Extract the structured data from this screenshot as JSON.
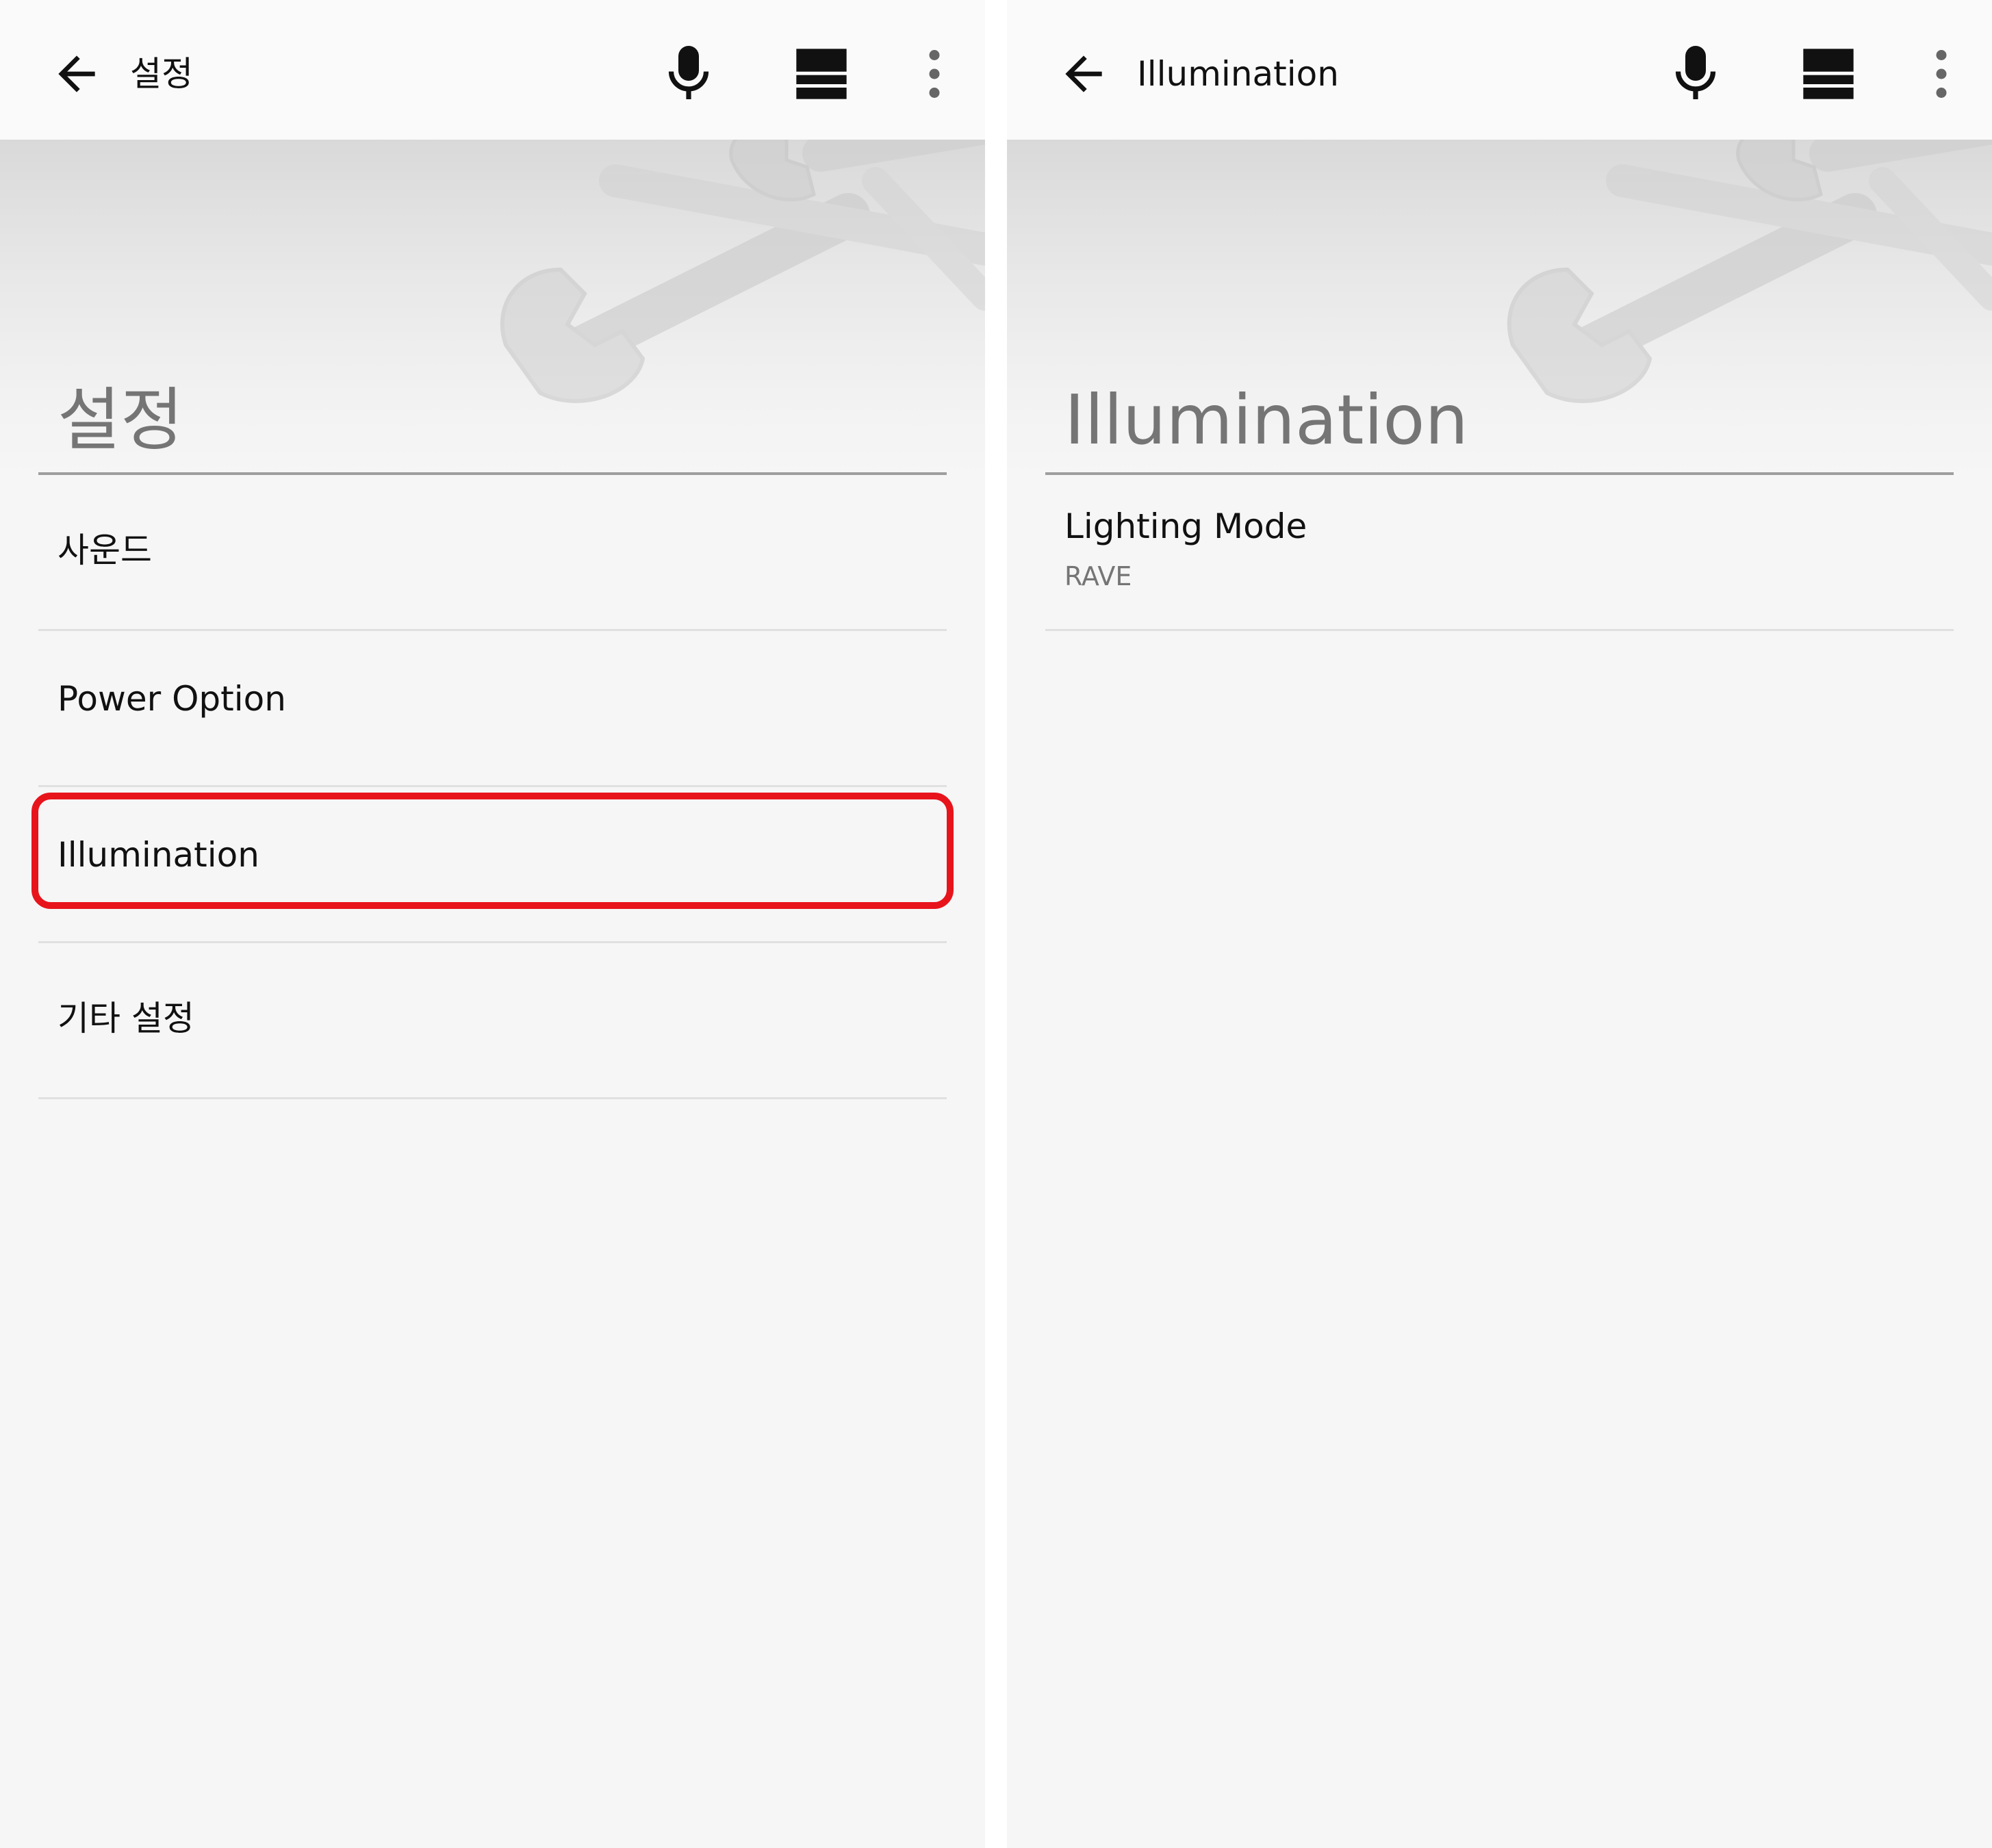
{
  "left_screen": {
    "toolbar": {
      "title": "설정"
    },
    "page_title": "설정",
    "items": [
      {
        "label": "사운드"
      },
      {
        "label": "Power Option"
      },
      {
        "label": "Illumination",
        "highlighted": true
      },
      {
        "label": "기타 설정"
      }
    ]
  },
  "right_screen": {
    "toolbar": {
      "title": "Illumination"
    },
    "page_title": "Illumination",
    "items": [
      {
        "label": "Lighting Mode",
        "value": "RAVE"
      }
    ]
  },
  "colors": {
    "highlight": "#e8141c",
    "toolbar_background": "#fafafa",
    "page_background": "#f6f6f6"
  },
  "icons": [
    "back-arrow-icon",
    "microphone-icon",
    "grid-view-icon",
    "more-vert-icon",
    "wrench-icon"
  ]
}
